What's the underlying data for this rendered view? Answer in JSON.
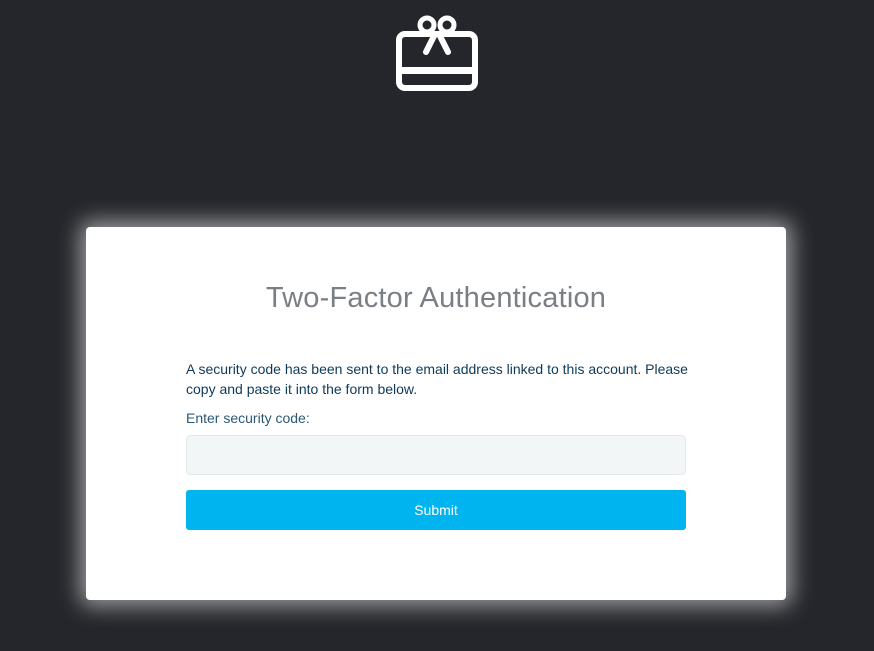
{
  "logo": {
    "icon": "gift-card-icon",
    "color": "#ffffff"
  },
  "card": {
    "title": "Two-Factor Authentication",
    "message": "A security code has been sent to the email address linked to this account. Please copy and paste it into the form below.",
    "code_label": "Enter security code:",
    "code_input": {
      "value": "",
      "placeholder": ""
    },
    "submit_label": "Submit"
  },
  "colors": {
    "background": "#24262b",
    "accent": "#00b4ef",
    "title_text": "#7a7f85",
    "body_text": "#0e3a5a"
  }
}
